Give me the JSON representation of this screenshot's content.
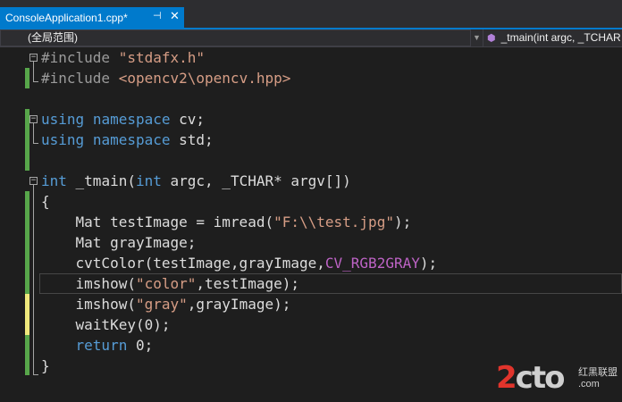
{
  "tab": {
    "title": "ConsoleApplication1.cpp*",
    "pin": "⊣",
    "close": "✕"
  },
  "nav": {
    "scope": "(全局范围)",
    "func": "_tmain(int argc, _TCHAR"
  },
  "code": {
    "l1": [
      "#include ",
      "\"stdafx.h\""
    ],
    "l2": [
      "#include ",
      "<opencv2\\opencv.hpp>"
    ],
    "l4": [
      "using",
      " ",
      "namespace",
      " cv;"
    ],
    "l5": [
      "using",
      " ",
      "namespace",
      " std;"
    ],
    "l7": [
      "int",
      " _tmain(",
      "int",
      " argc, _TCHAR* argv[])"
    ],
    "l8": "{",
    "l9": [
      "    Mat testImage = imread(",
      "\"F:\\\\test.jpg\"",
      ");"
    ],
    "l10": "    Mat grayImage;",
    "l11": [
      "    cvtColor(testImage,grayImage,",
      "CV_RGB2GRAY",
      ");"
    ],
    "l12": [
      "    imshow(",
      "\"color\"",
      ",testImage);"
    ],
    "l13": [
      "    imshow(",
      "\"gray\"",
      ",grayImage);"
    ],
    "l14": "    waitKey(0);",
    "l15": [
      "    ",
      "return",
      " 0;"
    ],
    "l16": "}"
  },
  "watermark": {
    "main_a": "2",
    "main_b": "cto",
    "sub": "红黑联盟",
    "site": ".com"
  },
  "colors": {
    "accent": "#007acc",
    "change_saved": "#57a64a",
    "change_unsaved": "#efe87c"
  }
}
